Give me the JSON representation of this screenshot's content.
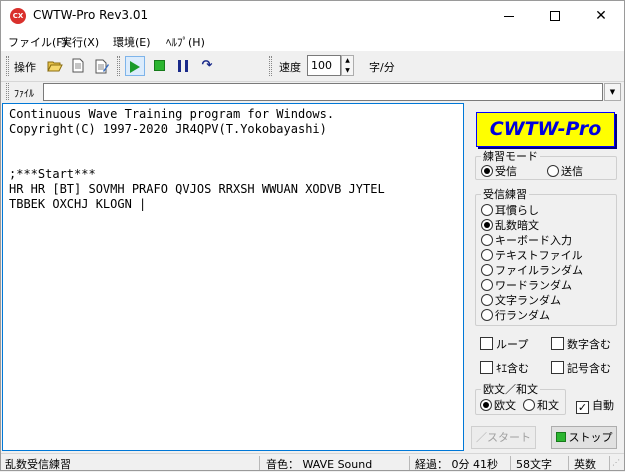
{
  "window": {
    "title": "CWTW-Pro Rev3.01",
    "icon_text": "CX"
  },
  "menu": [
    {
      "label": "ファイル(F)"
    },
    {
      "label": "実行(X)"
    },
    {
      "label": "環境(E)"
    },
    {
      "label": "ﾍﾙﾌﾟ(H)"
    }
  ],
  "toolbar": {
    "operation_label": "操作",
    "speed_label": "速度",
    "speed_value": "100",
    "speed_unit": "字/分"
  },
  "filebar": {
    "label": "ﾌｧｲﾙ",
    "value": ""
  },
  "main_text": {
    "line1": "Continuous Wave Training program for Windows.",
    "line2": "Copyright(C) 1997-2020 JR4QPV(T.Yokobayashi)",
    "line3": "",
    "line4": "",
    "line5": ";***Start***",
    "line6": "HR HR [BT] SOVMH PRAFO QVJOS RRXSH WWUAN XODVB JYTEL",
    "line7": "TBBEK OXCHJ KLOGN |"
  },
  "logo": "CWTW-Pro",
  "mode_group": {
    "legend": "練習モード",
    "options": [
      "受信",
      "送信"
    ],
    "selected": "受信"
  },
  "receive_group": {
    "legend": "受信練習",
    "options": [
      "耳慣らし",
      "乱数暗文",
      "キーボード入力",
      "テキストファイル",
      "ファイルランダム",
      "ワードランダム",
      "文字ランダム",
      "行ランダム"
    ],
    "selected": "乱数暗文"
  },
  "checks": {
    "loop": {
      "label": "ループ",
      "checked": false
    },
    "numbers": {
      "label": "数字含む",
      "checked": false
    },
    "kana": {
      "label": "ｷｴ含む",
      "checked": false
    },
    "symbols": {
      "label": "記号含む",
      "checked": false
    }
  },
  "lang_group": {
    "legend": "欧文／和文",
    "options": [
      "欧文",
      "和文"
    ],
    "selected": "欧文",
    "auto_label": "自動",
    "auto_checked": true
  },
  "buttons": {
    "start": "スタート",
    "stop": "ストップ"
  },
  "status": {
    "mode": "乱数受信練習",
    "tone": "音色： WAVE Sound",
    "elapsed": "経過： 0分 41秒",
    "count": "58文字",
    "lang": "英数"
  }
}
